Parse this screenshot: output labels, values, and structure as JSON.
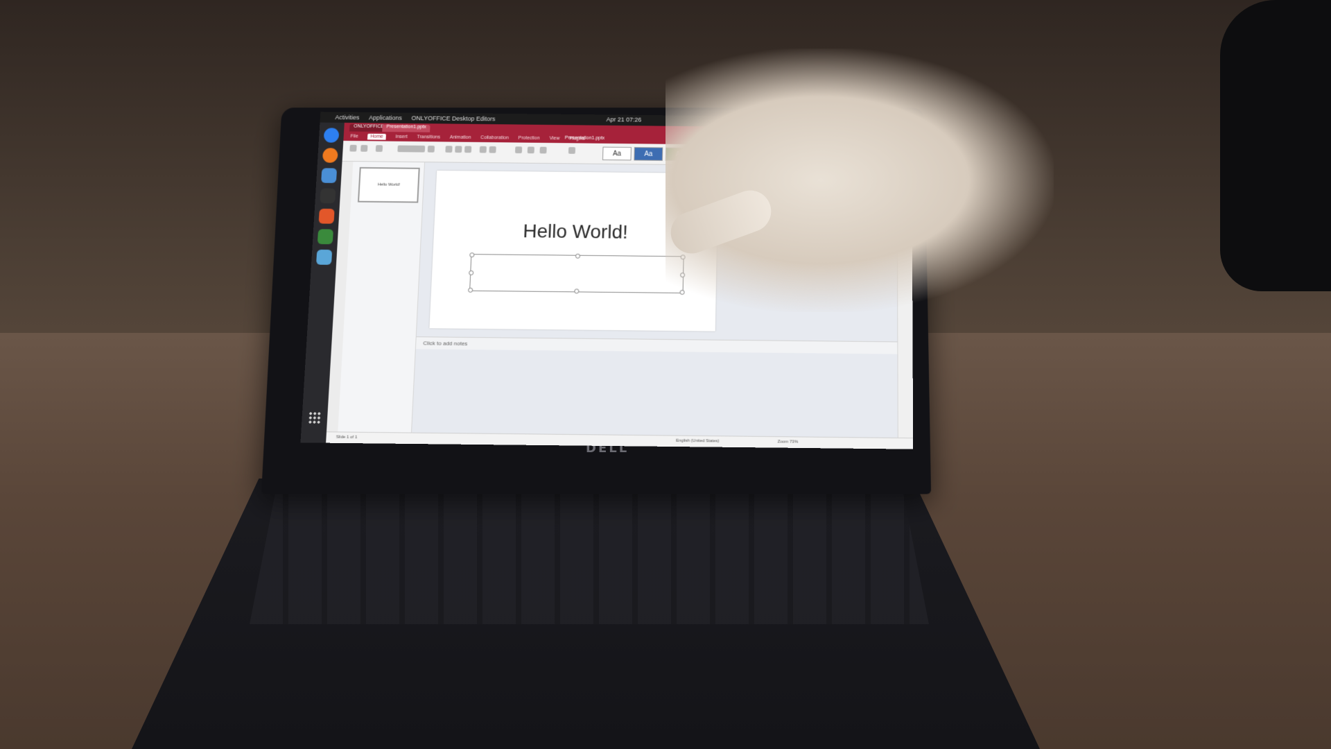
{
  "topbar": {
    "activities": "Activities",
    "applications": "Applications",
    "app_name": "ONLYOFFICE Desktop Editors",
    "clock": "Apr 21 07:26"
  },
  "editor": {
    "file_name": "Presentation1.pptx",
    "tabs": [
      "File",
      "Home",
      "Insert",
      "Transitions",
      "Animation",
      "Collaboration",
      "Protection",
      "View",
      "Plugins"
    ],
    "active_tab": "Home",
    "theme_label": "Aa"
  },
  "slide": {
    "title": "Hello World!",
    "thumbnail_text": "Hello World!"
  },
  "notes_placeholder": "Click to add notes",
  "status": {
    "slide_counter": "Slide 1 of 1",
    "language": "English (United States)",
    "zoom": "Zoom 73%"
  },
  "device": {
    "brand": "DELL"
  },
  "colors": {
    "accent": "#a6223a",
    "screen_bg": "#eef1f6"
  }
}
